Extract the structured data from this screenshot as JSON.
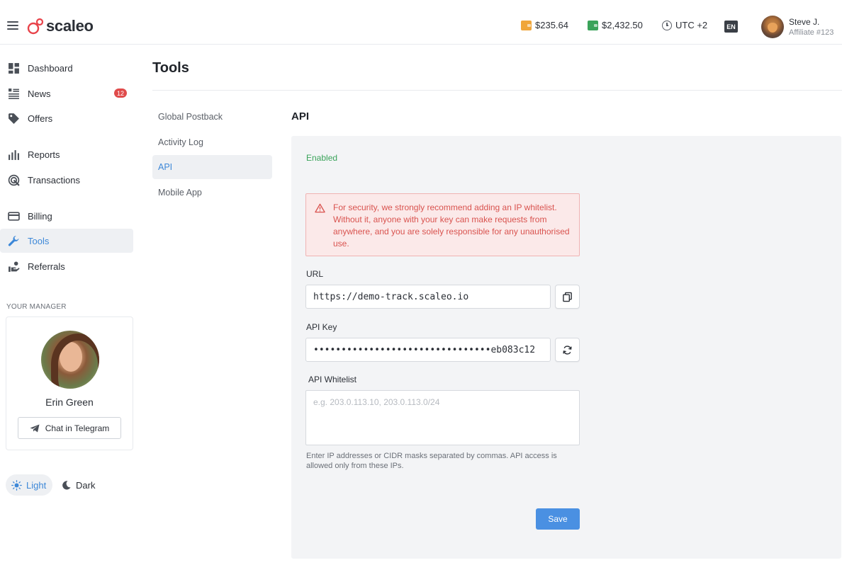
{
  "header": {
    "menu_icon": "hamburger-icon",
    "logo_text": "scaleo",
    "balances": [
      {
        "amount": "$235.64",
        "icon": "wallet-icon",
        "color": "#f0a63a"
      },
      {
        "amount": "$2,432.50",
        "icon": "wallet-icon",
        "color": "#3aa35a"
      }
    ],
    "timezone": "UTC +2",
    "language": "EN",
    "user": {
      "name": "Steve J.",
      "subtitle": "Affiliate #123"
    }
  },
  "sidebar": {
    "items": [
      {
        "label": "Dashboard",
        "icon": "dashboard-icon"
      },
      {
        "label": "News",
        "icon": "news-icon",
        "badge": "12"
      },
      {
        "label": "Offers",
        "icon": "tag-icon"
      },
      {
        "label": "Reports",
        "icon": "bar-chart-icon"
      },
      {
        "label": "Transactions",
        "icon": "transactions-icon"
      },
      {
        "label": "Billing",
        "icon": "credit-card-icon"
      },
      {
        "label": "Tools",
        "icon": "wrench-icon",
        "active": true
      },
      {
        "label": "Referrals",
        "icon": "referrals-icon"
      }
    ],
    "manager": {
      "title": "YOUR MANAGER",
      "name": "Erin Green",
      "chat_label": "Chat in Telegram"
    },
    "theme": {
      "light": "Light",
      "dark": "Dark"
    }
  },
  "main": {
    "title": "Tools",
    "sub_nav": [
      {
        "label": "Global Postback"
      },
      {
        "label": "Activity Log"
      },
      {
        "label": "API",
        "active": true
      },
      {
        "label": "Mobile App"
      }
    ],
    "section_title": "API",
    "status": "Enabled",
    "alert": "For security, we strongly recommend adding an IP whitelist. Without it, anyone with your key can make requests from anywhere, and you are solely responsible for any unauthorised use.",
    "url": {
      "label": "URL",
      "value": "https://demo-track.scaleo.io"
    },
    "api_key": {
      "label": "API Key",
      "value": "••••••••••••••••••••••••••••••••eb083c12"
    },
    "whitelist": {
      "label": "API Whitelist",
      "placeholder": "e.g. 203.0.113.10, 203.0.113.0/24",
      "help": "Enter IP addresses or CIDR masks separated by commas. API access is allowed only from these IPs."
    },
    "save_label": "Save"
  },
  "colors": {
    "accent": "#3d88d8",
    "primary_button": "#4a90e2",
    "success": "#3aa35a",
    "danger": "#d9534f",
    "badge": "#e04b4b"
  }
}
